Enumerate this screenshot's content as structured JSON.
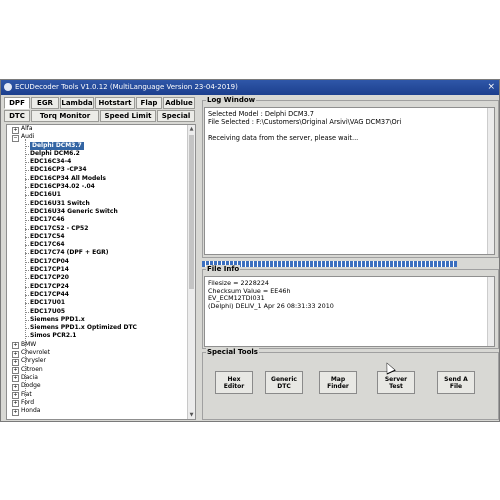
{
  "window": {
    "title": "ECUDecoder Tools  V1.0.12 (MultiLanguage Version 23-04-2019)",
    "close_glyph": "×"
  },
  "tabs_row1": [
    "DPF",
    "EGR",
    "Lambda",
    "Hotstart",
    "Flap",
    "Adblue"
  ],
  "tabs_row2": [
    "DTC",
    "Torq Monitor",
    "Speed Limit",
    "Special"
  ],
  "tree": [
    {
      "label": "Alfa",
      "level": 0,
      "expander": "+"
    },
    {
      "label": "Audi",
      "level": 0,
      "expander": "−"
    },
    {
      "label": "Delphi DCM3.7",
      "level": 1,
      "selected": true
    },
    {
      "label": "Delphi DCM6.2",
      "level": 1
    },
    {
      "label": "EDC16C34-4",
      "level": 1
    },
    {
      "label": "EDC16CP3 -CP34",
      "level": 1
    },
    {
      "label": "EDC16CP34 All Models",
      "level": 1
    },
    {
      "label": "EDC16CP34.02 -.04",
      "level": 1
    },
    {
      "label": "EDC16U1",
      "level": 1
    },
    {
      "label": "EDC16U31 Switch",
      "level": 1
    },
    {
      "label": "EDC16U34 Generic Switch",
      "level": 1
    },
    {
      "label": "EDC17C46",
      "level": 1
    },
    {
      "label": "EDC17C52 - CP52",
      "level": 1
    },
    {
      "label": "EDC17C54",
      "level": 1
    },
    {
      "label": "EDC17C64",
      "level": 1
    },
    {
      "label": "EDC17C74 (DPF + EGR)",
      "level": 1
    },
    {
      "label": "EDC17CP04",
      "level": 1
    },
    {
      "label": "EDC17CP14",
      "level": 1
    },
    {
      "label": "EDC17CP20",
      "level": 1
    },
    {
      "label": "EDC17CP24",
      "level": 1
    },
    {
      "label": "EDC17CP44",
      "level": 1
    },
    {
      "label": "EDC17U01",
      "level": 1
    },
    {
      "label": "EDC17U05",
      "level": 1
    },
    {
      "label": "Siemens PPD1.x",
      "level": 1
    },
    {
      "label": "Siemens PPD1.x Optimized DTC",
      "level": 1
    },
    {
      "label": "Simos PCR2.1",
      "level": 1
    },
    {
      "label": "BMW",
      "level": 0,
      "expander": "+"
    },
    {
      "label": "Chevrolet",
      "level": 0,
      "expander": "+"
    },
    {
      "label": "Chrysler",
      "level": 0,
      "expander": "+"
    },
    {
      "label": "Citroen",
      "level": 0,
      "expander": "+"
    },
    {
      "label": "Dacia",
      "level": 0,
      "expander": "+"
    },
    {
      "label": "Dodge",
      "level": 0,
      "expander": "+"
    },
    {
      "label": "Fiat",
      "level": 0,
      "expander": "+"
    },
    {
      "label": "Ford",
      "level": 0,
      "expander": "+"
    },
    {
      "label": "Honda",
      "level": 0,
      "expander": "+"
    }
  ],
  "log_window": {
    "label": "Log Window",
    "lines": [
      "Selected Model : Delphi DCM3.7",
      "File Selected : F:\\Customers\\Original Arsivi\\VAG DCM37\\Ori",
      "",
      "Receiving data from the server, please wait..."
    ]
  },
  "file_info": {
    "label": "File Info",
    "lines": [
      "Filesize = 2228224",
      "Checksum Value = EE46h",
      "EV_ECM12TDI031",
      "(Delphi) DELIV_1 Apr 26 08:31:33 2010"
    ]
  },
  "special_tools": {
    "label": "Special Tools",
    "buttons": [
      "Hex\nEditor",
      "Generic\nDTC",
      "Map\nFinder",
      "Server\nTest",
      "Send A\nFile"
    ]
  },
  "colors": {
    "titlebar": "#1c3f8e",
    "selection": "#3465a4",
    "progress": "#3b6fbf"
  }
}
